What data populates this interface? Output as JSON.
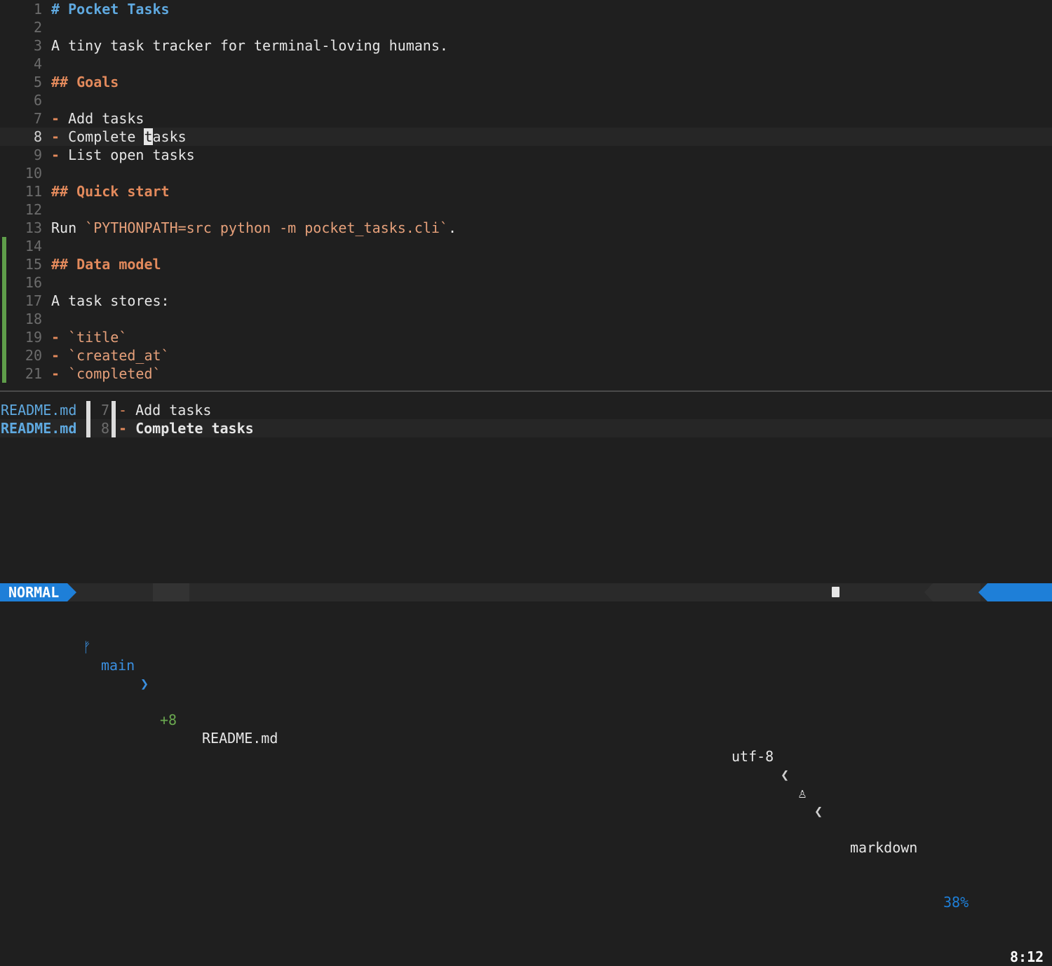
{
  "editor": {
    "lines": [
      {
        "n": "1",
        "parts": [
          {
            "t": "# Pocket Tasks",
            "c": "h"
          }
        ]
      },
      {
        "n": "2",
        "parts": []
      },
      {
        "n": "3",
        "parts": [
          {
            "t": "A tiny task tracker for terminal-loving humans.",
            "c": ""
          }
        ]
      },
      {
        "n": "4",
        "parts": []
      },
      {
        "n": "5",
        "parts": [
          {
            "t": "## Goals",
            "c": "h2"
          }
        ]
      },
      {
        "n": "6",
        "parts": []
      },
      {
        "n": "7",
        "parts": [
          {
            "t": "- ",
            "c": "h2"
          },
          {
            "t": "Add tasks",
            "c": ""
          }
        ]
      },
      {
        "n": "8",
        "current": true,
        "parts": [
          {
            "t": "- ",
            "c": "h2"
          },
          {
            "t": "Complete ",
            "c": ""
          },
          {
            "t": "t",
            "c": "cursor"
          },
          {
            "t": "asks",
            "c": ""
          }
        ]
      },
      {
        "n": "9",
        "parts": [
          {
            "t": "- ",
            "c": "h2"
          },
          {
            "t": "List open tasks",
            "c": ""
          }
        ]
      },
      {
        "n": "10",
        "parts": []
      },
      {
        "n": "11",
        "parts": [
          {
            "t": "## Quick start",
            "c": "h2"
          }
        ]
      },
      {
        "n": "12",
        "parts": []
      },
      {
        "n": "13",
        "parts": [
          {
            "t": "Run ",
            "c": ""
          },
          {
            "t": "`PYTHONPATH=src python -m pocket_tasks.cli`",
            "c": "code"
          },
          {
            "t": ".",
            "c": ""
          }
        ]
      },
      {
        "n": "14",
        "added": true,
        "parts": []
      },
      {
        "n": "15",
        "added": true,
        "parts": [
          {
            "t": "## Data model",
            "c": "h2"
          }
        ]
      },
      {
        "n": "16",
        "added": true,
        "parts": []
      },
      {
        "n": "17",
        "added": true,
        "parts": [
          {
            "t": "A task stores:",
            "c": ""
          }
        ]
      },
      {
        "n": "18",
        "added": true,
        "parts": []
      },
      {
        "n": "19",
        "added": true,
        "parts": [
          {
            "t": "- ",
            "c": "h2"
          },
          {
            "t": "`title`",
            "c": "code"
          }
        ]
      },
      {
        "n": "20",
        "added": true,
        "parts": [
          {
            "t": "- ",
            "c": "h2"
          },
          {
            "t": "`created_at`",
            "c": "code"
          }
        ]
      },
      {
        "n": "21",
        "added": true,
        "parts": [
          {
            "t": "- ",
            "c": "h2"
          },
          {
            "t": "`completed`",
            "c": "code"
          }
        ]
      }
    ]
  },
  "quickfix": {
    "items": [
      {
        "file": "README.md",
        "lnum": "7",
        "dash": "-",
        "text": " Add tasks",
        "selected": false
      },
      {
        "file": "README.md",
        "lnum": "8",
        "dash": "-",
        "text": " Complete tasks",
        "selected": true
      }
    ]
  },
  "statusline": {
    "mode": "NORMAL",
    "branch_icon": "git-branch-icon",
    "branch": "main",
    "diff": "+8",
    "filename": "README.md",
    "encoding": "utf-8",
    "os_icon": "linux-icon",
    "filetype_icon": "file-icon",
    "filetype": "markdown",
    "percent": "38%",
    "position": "8:12"
  },
  "colors": {
    "background": "#1f1f1f",
    "accent": "#1e7fd8",
    "heading": "#5fa9e0",
    "subheading": "#e38a5c",
    "added": "#5f9e4a"
  }
}
